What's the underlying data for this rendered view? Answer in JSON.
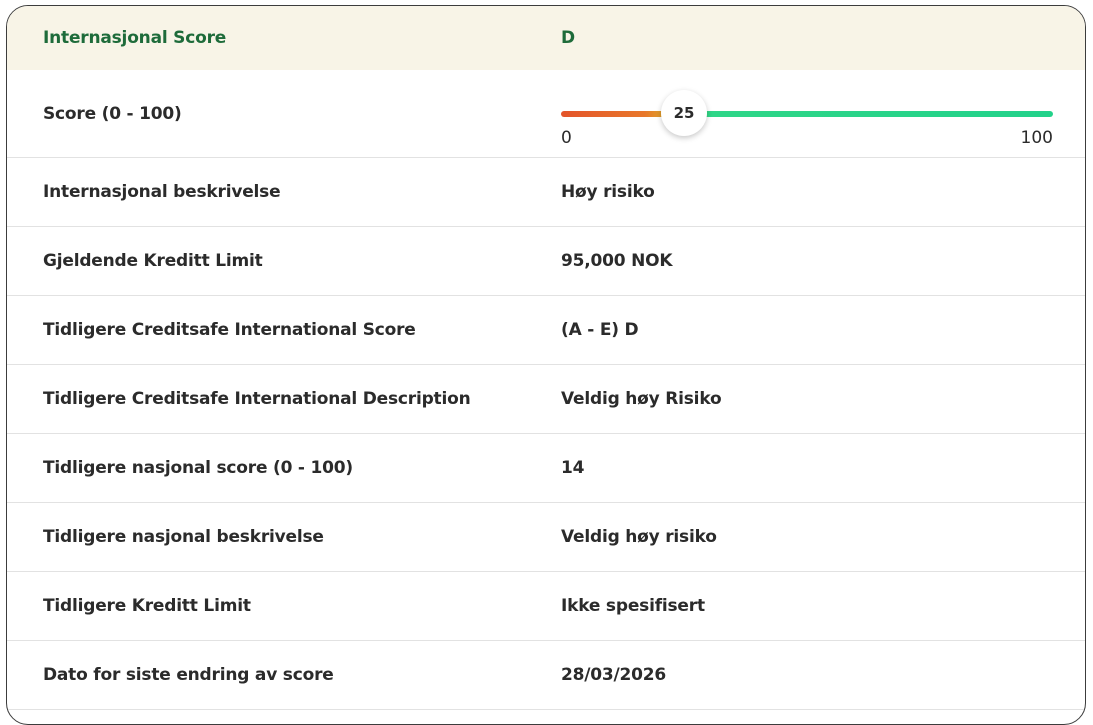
{
  "header": {
    "label": "Internasjonal Score",
    "value": "D"
  },
  "score": {
    "label": "Score (0 - 100)",
    "value": 25,
    "display": "25",
    "min_label": "0",
    "max_label": "100",
    "min": 0,
    "max": 100,
    "colors": {
      "low": "#e4542a",
      "mid": "#d6c22c",
      "high": "#22d28a"
    }
  },
  "rows": [
    {
      "label": "Internasjonal beskrivelse",
      "value": "Høy risiko"
    },
    {
      "label": "Gjeldende Kreditt Limit",
      "value": "95,000 NOK"
    },
    {
      "label": "Tidligere Creditsafe International Score",
      "value": "(A - E) D"
    },
    {
      "label": "Tidligere Creditsafe International Description",
      "value": "Veldig høy Risiko"
    },
    {
      "label": "Tidligere nasjonal score (0 - 100)",
      "value": "14"
    },
    {
      "label": "Tidligere nasjonal beskrivelse",
      "value": "Veldig høy risiko"
    },
    {
      "label": "Tidligere Kreditt Limit",
      "value": "Ikke spesifisert"
    },
    {
      "label": "Dato for siste endring av score",
      "value": "28/03/2026"
    }
  ],
  "colors": {
    "header_bg": "#f8f4e7",
    "header_text": "#1e6b3a",
    "border": "#3c3c3c",
    "divider": "#e2e2e2"
  }
}
